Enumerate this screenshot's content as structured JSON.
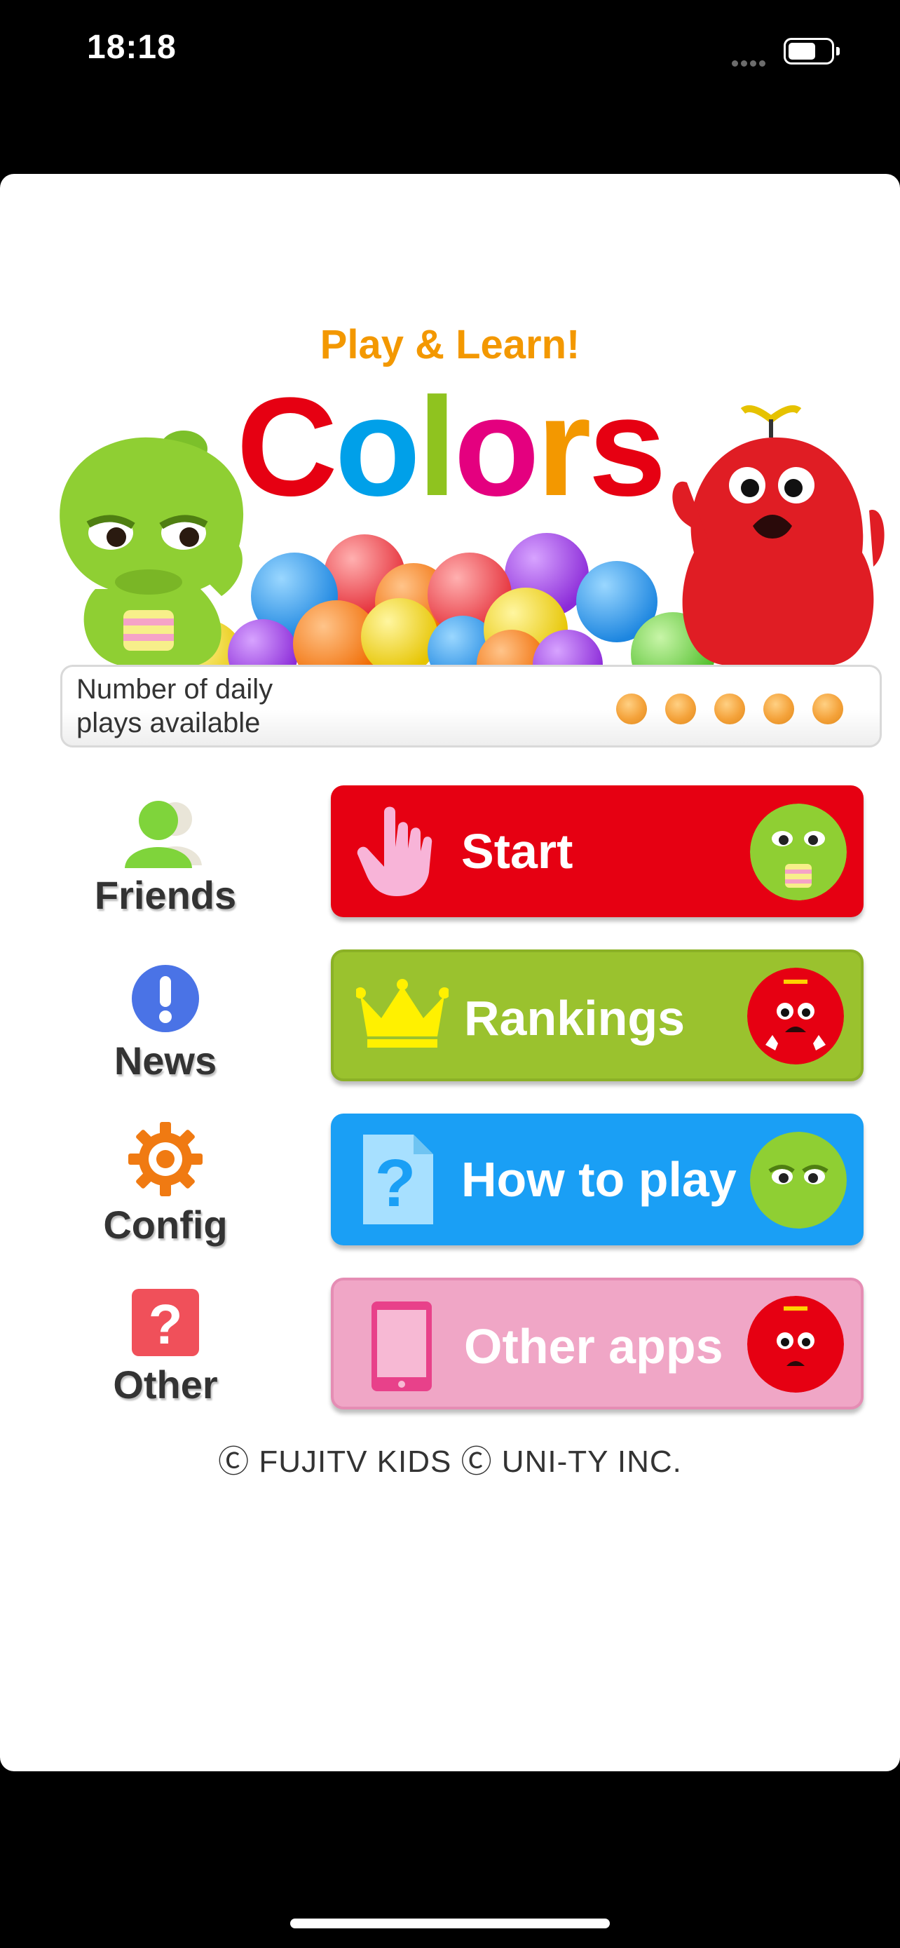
{
  "status_bar": {
    "time": "18:18"
  },
  "header": {
    "subtitle": "Play & Learn!",
    "title_letters": [
      {
        "char": "C",
        "color": "#e60012"
      },
      {
        "char": "o",
        "color": "#00a0e9"
      },
      {
        "char": "l",
        "color": "#8fc31f"
      },
      {
        "char": "o",
        "color": "#e4007f"
      },
      {
        "char": "r",
        "color": "#f39800"
      },
      {
        "char": "s",
        "color": "#e60012"
      }
    ]
  },
  "plays_panel": {
    "label": "Number of daily\nplays available",
    "plays_remaining": 5
  },
  "side_menu": [
    {
      "label": "Friends",
      "icon": "friends-icon"
    },
    {
      "label": "News",
      "icon": "exclamation-icon"
    },
    {
      "label": "Config",
      "icon": "gear-icon"
    },
    {
      "label": "Other",
      "icon": "question-icon"
    }
  ],
  "buttons": [
    {
      "label": "Start",
      "icon": "pointing-hand-icon",
      "face": "green-character-face",
      "color": "#e60012"
    },
    {
      "label": "Rankings",
      "icon": "crown-icon",
      "face": "red-character-face",
      "color": "#9ac22e"
    },
    {
      "label": "How to play",
      "icon": "help-document-icon",
      "face": "green-character-face",
      "color": "#1a9ff5"
    },
    {
      "label": "Other apps",
      "icon": "smartphone-icon",
      "face": "red-character-face",
      "color": "#f0a6c6"
    }
  ],
  "footer": {
    "copyright": "Ⓒ FUJITV KIDS  Ⓒ UNI-TY INC."
  }
}
